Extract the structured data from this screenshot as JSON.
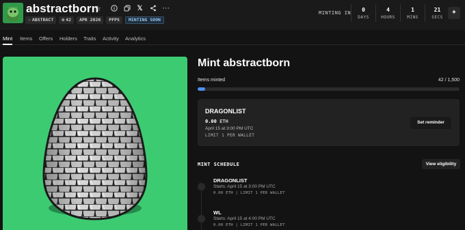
{
  "header": {
    "title": "abstractborn",
    "icons": [
      "star-icon",
      "info-icon",
      "copy-icon",
      "x-logo-icon",
      "share-icon",
      "more-icon"
    ],
    "badges": [
      {
        "icon": "abstract-icon",
        "label": "ABSTRACT"
      },
      {
        "icon": "items-icon",
        "label": "42"
      },
      {
        "label": "APR 2026"
      },
      {
        "label": "PFPS"
      },
      {
        "label": "MINTING SOON"
      }
    ],
    "minting_in_label": "MINTING IN",
    "countdown": [
      {
        "value": "0",
        "label": "DAYS"
      },
      {
        "value": "4",
        "label": "HOURS"
      },
      {
        "value": "1",
        "label": "MINS"
      },
      {
        "value": "21",
        "label": "SECS"
      }
    ]
  },
  "tabs": [
    "Mint",
    "Items",
    "Offers",
    "Holders",
    "Traits",
    "Activity",
    "Analytics"
  ],
  "active_tab": "Mint",
  "mint": {
    "title": "Mint abstractborn",
    "items_minted_label": "Items minted",
    "items_minted_count": "42 / 1,500",
    "progress_fraction": 0.028,
    "current_phase": {
      "name": "DRAGONLIST",
      "price": "0.00",
      "currency": "ETH",
      "date": "April 15 at 3:00 PM UTC",
      "limit": "LIMIT 1 PER WALLET",
      "reminder_label": "Set reminder"
    },
    "schedule_title": "MINT SCHEDULE",
    "eligibility_label": "View eligibility",
    "schedule": [
      {
        "name": "DRAGONLIST",
        "starts": "Starts: April 15 at 3:00 PM UTC",
        "price": "0.00",
        "currency": "ETH",
        "limit": "LIMIT 1 PER WALLET"
      },
      {
        "name": "WL",
        "starts": "Starts: April 15 at 4:00 PM UTC",
        "price": "0.00",
        "currency": "ETH",
        "limit": "LIMIT 1 PER WALLET"
      }
    ]
  },
  "colors": {
    "background": "#131313",
    "art_background": "#3dcb72",
    "progress": "#4f8ff0"
  }
}
